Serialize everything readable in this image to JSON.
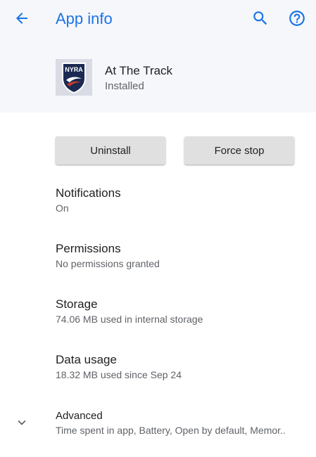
{
  "header": {
    "title": "App info"
  },
  "app": {
    "name": "At The Track",
    "status": "Installed",
    "icon_text": "NYRA"
  },
  "buttons": {
    "uninstall_label": "Uninstall",
    "force_stop_label": "Force stop"
  },
  "items": [
    {
      "title": "Notifications",
      "subtitle": "On"
    },
    {
      "title": "Permissions",
      "subtitle": "No permissions granted"
    },
    {
      "title": "Storage",
      "subtitle": "74.06 MB used in internal storage"
    },
    {
      "title": "Data usage",
      "subtitle": "18.32 MB used since Sep 24"
    },
    {
      "title": "Advanced",
      "subtitle": "Time spent in app, Battery, Open by default, Memor.."
    }
  ],
  "colors": {
    "accent": "#1a73e8",
    "header_bg": "#f5f7fa",
    "button_bg": "#e0e0e0",
    "secondary_text": "#5f6368"
  },
  "icons": {
    "back": "arrow-back-icon",
    "search": "search-icon",
    "help": "help-circle-icon",
    "expand": "chevron-down-icon"
  }
}
